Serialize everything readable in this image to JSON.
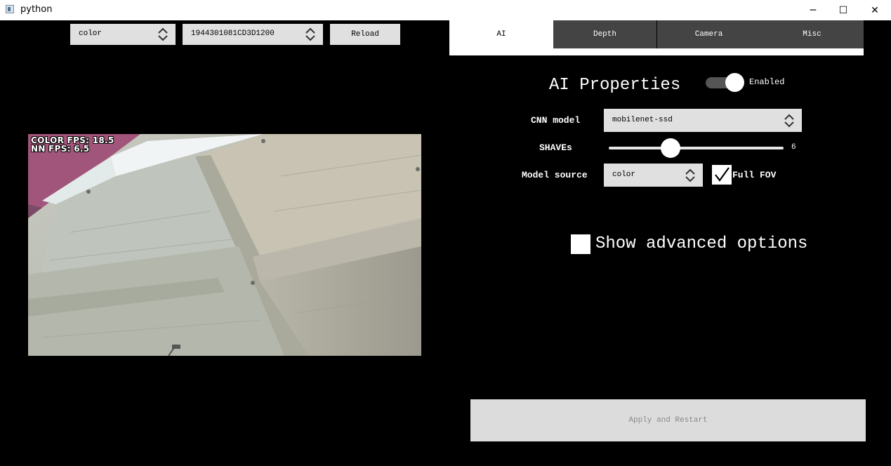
{
  "window": {
    "title": "python",
    "minimize": "─",
    "maximize": "☐",
    "close": "✕"
  },
  "preview_controls": {
    "source_value": "color",
    "device_value": "1944301081CD3D1200",
    "reload_label": "Reload"
  },
  "preview": {
    "color_fps": "COLOR FPS: 18.5",
    "nn_fps": "NN FPS:  6.5"
  },
  "tabs": [
    {
      "label": "AI",
      "active": true
    },
    {
      "label": "Depth",
      "active": false
    },
    {
      "label": "Camera",
      "active": false
    },
    {
      "label": "Misc",
      "active": false
    }
  ],
  "ai": {
    "title": "AI Properties",
    "enabled_label": "Enabled",
    "enabled": true,
    "cnn_model_label": "CNN model",
    "cnn_model_value": "mobilenet-ssd",
    "shaves_label": "SHAVEs",
    "shaves_value": "6",
    "shaves_fraction": 0.33,
    "model_source_label": "Model source",
    "model_source_value": "color",
    "full_fov_label": "Full FOV",
    "full_fov_checked": true,
    "advanced_label": "Show advanced options",
    "advanced_checked": false
  },
  "apply_label": "Apply and Restart",
  "colors": {
    "background": "#000000",
    "control": "#e0e0e0",
    "tab_inactive": "#444444",
    "apply_text": "#8a8a8a"
  }
}
